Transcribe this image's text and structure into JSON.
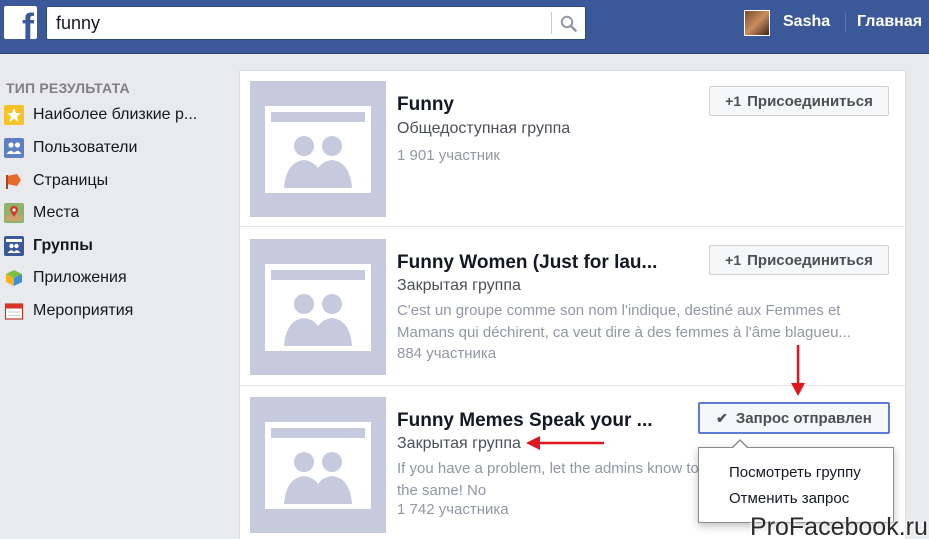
{
  "header": {
    "logo_letter": "f",
    "search_value": "funny",
    "user_name": "Sasha",
    "home_label": "Главная",
    "brand_color": "#3b5998"
  },
  "sidebar": {
    "heading": "ТИП РЕЗУЛЬТАТА",
    "items": [
      {
        "label": "Наиболее близкие р...",
        "icon": "star-icon",
        "active": false
      },
      {
        "label": "Пользователи",
        "icon": "people-icon",
        "active": false
      },
      {
        "label": "Страницы",
        "icon": "flag-icon",
        "active": false
      },
      {
        "label": "Места",
        "icon": "map-pin-icon",
        "active": false
      },
      {
        "label": "Группы",
        "icon": "groups-icon",
        "active": true
      },
      {
        "label": "Приложения",
        "icon": "apps-cube-icon",
        "active": false
      },
      {
        "label": "Мероприятия",
        "icon": "calendar-icon",
        "active": false
      }
    ]
  },
  "results": [
    {
      "title": "Funny",
      "privacy": "Общедоступная группа",
      "description": "",
      "members": "1 901 участник",
      "button_label": "Присоединиться",
      "button_prefix": "+1",
      "state": "join"
    },
    {
      "title": "Funny Women (Just for lau...",
      "privacy": "Закрытая группа",
      "description": "C'est un groupe comme son nom l'indique, destiné aux Femmes et Mamans qui déchirent, ca veut dire à des femmes à l'âme blagueu...",
      "members": "884 участника",
      "button_label": "Присоединиться",
      "button_prefix": "+1",
      "state": "join"
    },
    {
      "title": "Funny Memes Speak your ...",
      "privacy": "Закрытая группа",
      "description": "If you have a problem, let the admins know to your concerns. Rules stay the same! No",
      "members": "1 742 участника",
      "button_label": "Запрос отправлен",
      "button_prefix": "✔",
      "state": "request_sent"
    }
  ],
  "dropdown": {
    "items": [
      "Посмотреть группу",
      "Отменить запрос"
    ]
  },
  "watermark": "ProFacebook.ru",
  "annotation_color": "#e0171f"
}
